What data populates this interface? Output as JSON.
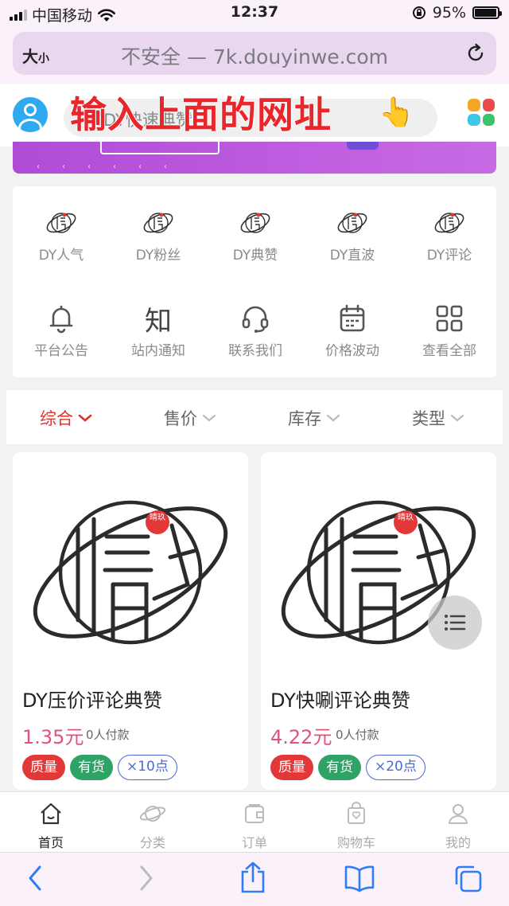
{
  "status_bar": {
    "carrier": "中国移动",
    "time": "12:37",
    "battery": "95%",
    "battery_level": 0.95
  },
  "browser": {
    "text_size_label": "大",
    "text_size_label_small": "小",
    "url": "不安全 — 7k.douyinwe.com",
    "reload_icon": "reload-icon"
  },
  "header": {
    "search_placeholder": "DY快速典赞",
    "overlay_caption": "输入上面的网址",
    "overlay_emoji": "👆",
    "menu_icon_colors": [
      "#f6a623",
      "#e94b4b",
      "#3cc6e8",
      "#3ec16b"
    ]
  },
  "categories": [
    {
      "label": "DY人气",
      "icon": "qingmei-logo-icon"
    },
    {
      "label": "DY粉丝",
      "icon": "qingmei-logo-icon"
    },
    {
      "label": "DY典赞",
      "icon": "qingmei-logo-icon"
    },
    {
      "label": "DY直波",
      "icon": "qingmei-logo-icon"
    },
    {
      "label": "DY评论",
      "icon": "qingmei-logo-icon"
    },
    {
      "label": "平台公告",
      "icon": "bell-icon"
    },
    {
      "label": "站内通知",
      "icon": "zhi-text-icon",
      "glyph": "知"
    },
    {
      "label": "联系我们",
      "icon": "headset-icon"
    },
    {
      "label": "价格波动",
      "icon": "calendar-icon"
    },
    {
      "label": "查看全部",
      "icon": "grid-icon"
    }
  ],
  "filters": [
    {
      "label": "综合",
      "active": true
    },
    {
      "label": "售价",
      "active": false
    },
    {
      "label": "库存",
      "active": false
    },
    {
      "label": "类型",
      "active": false
    }
  ],
  "products": [
    {
      "name": "DY压价评论典赞",
      "price": "1.35元",
      "sold": "0人付款",
      "tags": [
        "质量",
        "有货",
        "×10点"
      ],
      "logo_stamp": "晴玖"
    },
    {
      "name": "DY快唰评论典赞",
      "price": "4.22元",
      "sold": "0人付款",
      "tags": [
        "质量",
        "有货",
        "×20点"
      ],
      "logo_stamp": "晴玖"
    }
  ],
  "tabbar": [
    {
      "label": "首页",
      "icon": "home-icon",
      "active": true
    },
    {
      "label": "分类",
      "icon": "planet-icon",
      "active": false
    },
    {
      "label": "订单",
      "icon": "wallet-icon",
      "active": false
    },
    {
      "label": "购物车",
      "icon": "shopping-bag-icon",
      "active": false
    },
    {
      "label": "我的",
      "icon": "user-icon",
      "active": false
    }
  ],
  "colors": {
    "accent_red": "#d8352f",
    "price_pink": "#e2537a",
    "tag_red": "#e33838",
    "tag_green": "#2fa365",
    "tag_blue": "#4b6ad3",
    "safari_blue": "#2f7cf6"
  }
}
